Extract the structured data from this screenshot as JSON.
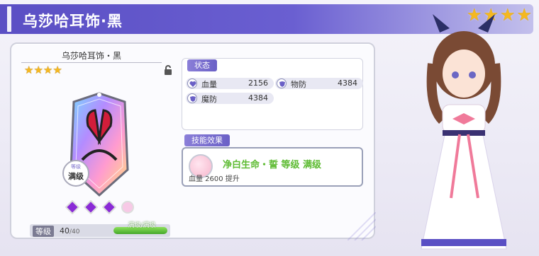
{
  "header": {
    "title": "乌莎哈耳饰·黑",
    "stars": 4
  },
  "item": {
    "name": "乌莎哈耳饰・黑",
    "stars": 4,
    "badge_sub": "等级",
    "badge_main": "满级",
    "gems_filled": 3,
    "gems_total": 4,
    "level_label": "等级",
    "level_current": "40",
    "level_max": "/40",
    "level_bar_label": "满级/满级",
    "level_progress": 1.0
  },
  "stats": {
    "tag": "状态",
    "items": [
      {
        "label": "血量",
        "value": "2156",
        "icon": "heart-icon"
      },
      {
        "label": "物防",
        "value": "4384",
        "icon": "shield-icon"
      },
      {
        "label": "魔防",
        "value": "4384",
        "icon": "shield-icon"
      }
    ]
  },
  "skill": {
    "tag": "技能效果",
    "name": "净白生命・誓  等级  满级",
    "description": "血量 2600 提升"
  },
  "colors": {
    "header_bg": "#5a4fc4",
    "tag_bg": "#7467d0",
    "star": "#f5b820",
    "skill_text": "#5dbb32",
    "level_bar": "#45a82a"
  }
}
